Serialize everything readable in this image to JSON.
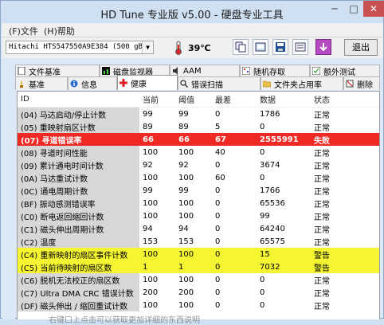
{
  "window": {
    "title": "HD Tune 专业版 v5.00 - 硬盘专业工具",
    "min_glyph": "─",
    "max_glyph": "□",
    "close_glyph": "✕"
  },
  "menu": [
    {
      "label": "(F)文件"
    },
    {
      "label": "(H)帮助"
    }
  ],
  "toolbar": {
    "drive": "Hitachi HTS547550A9E384 (500 gB)",
    "temperature": "39℃",
    "exit_label": "退出"
  },
  "tabs_row1": [
    {
      "label": "文件基准",
      "icon": "file-benchmark-icon"
    },
    {
      "label": "磁盘监视器",
      "icon": "disk-monitor-icon"
    },
    {
      "label": "AAM",
      "icon": "aam-speaker-icon"
    },
    {
      "label": "随机存取",
      "icon": "random-access-icon"
    },
    {
      "label": "额外测试",
      "icon": "extra-tests-icon"
    }
  ],
  "tabs_row2": [
    {
      "label": "基准",
      "icon": "benchmark-icon"
    },
    {
      "label": "信息",
      "icon": "info-icon"
    },
    {
      "label": "健康",
      "icon": "health-cross-icon",
      "active": true
    },
    {
      "label": "错误扫描",
      "icon": "error-scan-icon"
    },
    {
      "label": "文件夹占用率",
      "icon": "folder-usage-icon"
    },
    {
      "label": "删除",
      "icon": "erase-icon"
    }
  ],
  "table": {
    "headers": [
      "ID",
      "当前",
      "阈值",
      "最差",
      "数据",
      "状态"
    ],
    "rows": [
      {
        "id": "(04) 马达启动/停止计数",
        "cur": "99",
        "thr": "99",
        "worst": "0",
        "data": "1786",
        "status": "正常",
        "hl": ""
      },
      {
        "id": "(05) 重映射扇区计数",
        "cur": "89",
        "thr": "89",
        "worst": "5",
        "data": "0",
        "status": "正常",
        "hl": ""
      },
      {
        "id": "(07) 寻道错误率",
        "cur": "66",
        "thr": "66",
        "worst": "67",
        "data": "2555991",
        "status": "失败",
        "hl": "red"
      },
      {
        "id": "(08) 寻道时间性能",
        "cur": "100",
        "thr": "100",
        "worst": "40",
        "data": "0",
        "status": "正常",
        "hl": ""
      },
      {
        "id": "(09) 累计通电时间计数",
        "cur": "92",
        "thr": "92",
        "worst": "0",
        "data": "3674",
        "status": "正常",
        "hl": ""
      },
      {
        "id": "(0A) 马达重试计数",
        "cur": "100",
        "thr": "100",
        "worst": "60",
        "data": "0",
        "status": "正常",
        "hl": ""
      },
      {
        "id": "(0C) 通电周期计数",
        "cur": "99",
        "thr": "99",
        "worst": "0",
        "data": "1766",
        "status": "正常",
        "hl": ""
      },
      {
        "id": "(BF) 振动感测错误率",
        "cur": "100",
        "thr": "100",
        "worst": "0",
        "data": "65536",
        "status": "正常",
        "hl": ""
      },
      {
        "id": "(C0) 断电返回缩回计数",
        "cur": "100",
        "thr": "100",
        "worst": "0",
        "data": "99",
        "status": "正常",
        "hl": ""
      },
      {
        "id": "(C1) 磁头伸出周期计数",
        "cur": "94",
        "thr": "94",
        "worst": "0",
        "data": "64240",
        "status": "正常",
        "hl": ""
      },
      {
        "id": "(C2) 温度",
        "cur": "153",
        "thr": "153",
        "worst": "0",
        "data": "65575",
        "status": "正常",
        "hl": ""
      },
      {
        "id": "(C4) 重新映射的扇区事件计数",
        "cur": "100",
        "thr": "100",
        "worst": "0",
        "data": "15",
        "status": "警告",
        "hl": "yellow"
      },
      {
        "id": "(C5) 当前待映射的扇区数",
        "cur": "1",
        "thr": "1",
        "worst": "0",
        "data": "7032",
        "status": "警告",
        "hl": "yellow"
      },
      {
        "id": "(C6) 脱机无法校正的扇区数",
        "cur": "100",
        "thr": "100",
        "worst": "0",
        "data": "0",
        "status": "正常",
        "hl": ""
      },
      {
        "id": "(C7) Ultra DMA CRC 错误计数",
        "cur": "200",
        "thr": "200",
        "worst": "0",
        "data": "0",
        "status": "正常",
        "hl": ""
      },
      {
        "id": "(DF) 磁头伸出 / 缩回重试计数",
        "cur": "100",
        "thr": "100",
        "worst": "0",
        "data": "0",
        "status": "正常",
        "hl": ""
      }
    ]
  },
  "footer_text": "右键口上点击可以获取更加详细的东西说明",
  "colors": {
    "fail_row": "#ef2a24",
    "warn_row": "#f5f531",
    "id_cell": "#d7d7d7"
  }
}
